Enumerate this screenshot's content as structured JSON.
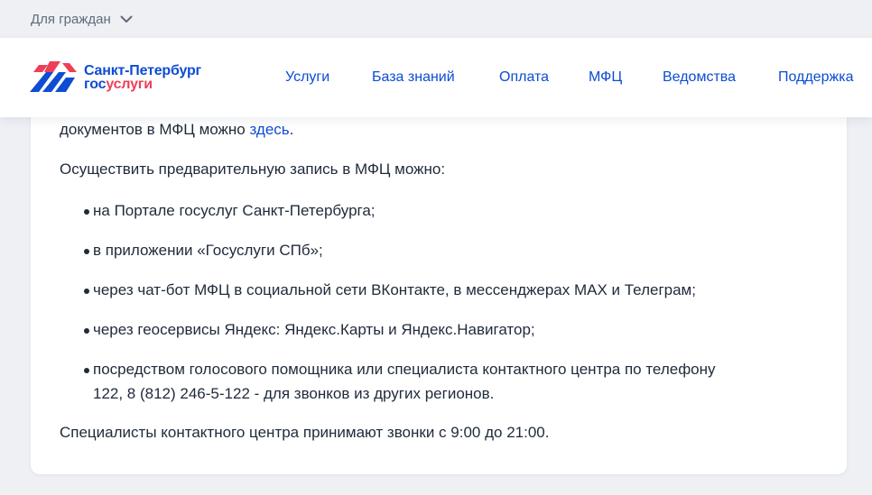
{
  "topbar": {
    "audience_label": "Для граждан"
  },
  "header": {
    "logo": {
      "line1": "Санкт-Петербург",
      "line2_part1": "гос",
      "line2_part2": "услуги"
    },
    "nav": [
      {
        "label": "Услуги"
      },
      {
        "label": "База знаний"
      },
      {
        "label": "Оплата"
      },
      {
        "label": "МФЦ"
      },
      {
        "label": "Ведомства"
      },
      {
        "label": "Поддержка"
      }
    ]
  },
  "content": {
    "intro_text": "документов в МФЦ можно ",
    "intro_link": "здесь",
    "intro_end": ".",
    "appointment_heading": "Осуществить предварительную запись в МФЦ можно:",
    "bullets": [
      "на Портале госуслуг Санкт-Петербурга;",
      "в приложении «Госуслуги СПб»;",
      "через чат-бот МФЦ в социальной сети ВКонтакте, в мессенджерах MAX и Телеграм;",
      "через геосервисы Яндекс: Яндекс.Карты и Яндекс.Навигатор;",
      "посредством голосового помощника или специалиста контактного центра по телефону",
      "122, 8 (812) 246-5-122 - для звонков из других регионов."
    ],
    "footer_text": "Специалисты контактного центра принимают звонки с 9:00 до 21:00."
  },
  "colors": {
    "brand_blue": "#0d4cd3",
    "brand_red": "#ee3f58",
    "text": "#1f2a3a",
    "muted": "#5f6b7c",
    "page_bg": "#eef0f4"
  },
  "icons": {
    "audience_toggle": "chevron-down-icon",
    "logo": "spb-gosuslugi-logo-icon"
  }
}
